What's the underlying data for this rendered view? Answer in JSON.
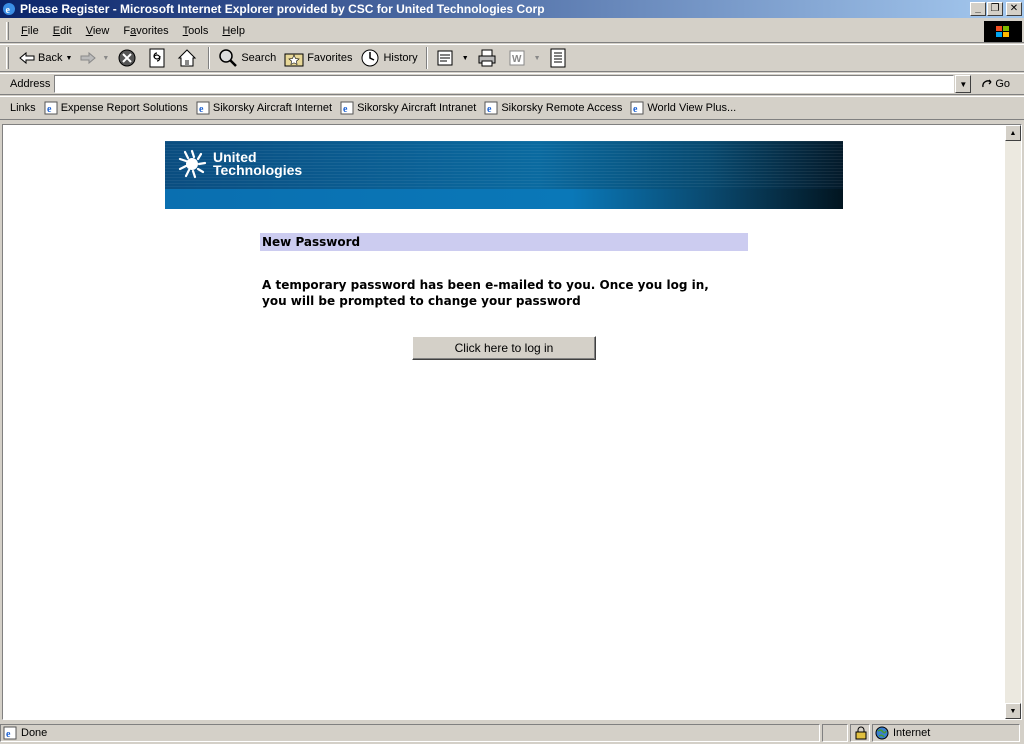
{
  "window": {
    "title": "Please Register - Microsoft Internet Explorer provided by CSC for United Technologies Corp",
    "minimize": "_",
    "maximize": "❐",
    "close": "✕"
  },
  "menu": {
    "items": [
      {
        "label": "File",
        "accel": "F",
        "rest": "ile"
      },
      {
        "label": "Edit",
        "accel": "E",
        "rest": "dit"
      },
      {
        "label": "View",
        "accel": "V",
        "rest": "iew"
      },
      {
        "label": "Favorites",
        "accel": "",
        "pre": "F",
        "accel2": "a",
        "rest": "vorites"
      },
      {
        "label": "Tools",
        "accel": "T",
        "rest": "ools"
      },
      {
        "label": "Help",
        "accel": "H",
        "rest": "elp"
      }
    ]
  },
  "toolbar": {
    "back": "Back",
    "search": "Search",
    "favorites": "Favorites",
    "history": "History"
  },
  "address": {
    "label": "Address",
    "value": "",
    "go": "Go"
  },
  "links": {
    "label": "Links",
    "items": [
      "Expense Report Solutions",
      "Sikorsky Aircraft Internet",
      "Sikorsky Aircraft Intranet",
      "Sikorsky Remote Access",
      "World View Plus..."
    ]
  },
  "page": {
    "logo_line1": "United",
    "logo_line2": "Technologies",
    "section_title": "New Password",
    "message_line1": "A temporary password has been e-mailed to you. Once you log in,",
    "message_line2": "you will be prompted to change your password",
    "login_button": "Click here to log in"
  },
  "status": {
    "text": "Done",
    "zone": "Internet"
  }
}
